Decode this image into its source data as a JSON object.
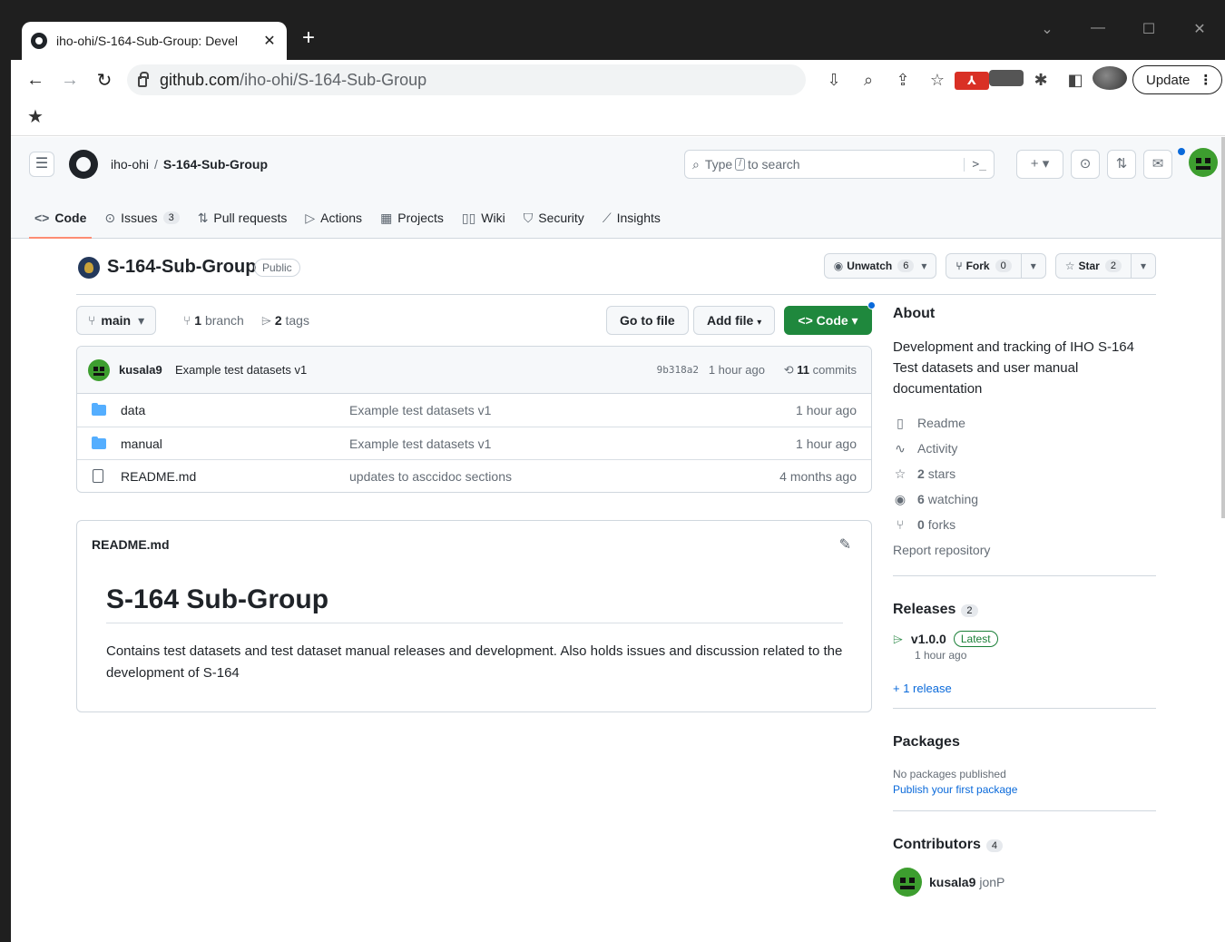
{
  "browser": {
    "tab_title": "iho-ohi/S-164-Sub-Group: Devel",
    "url_host": "github.com",
    "url_path": "/iho-ohi/S-164-Sub-Group",
    "update_label": "Update"
  },
  "header": {
    "owner": "iho-ohi",
    "separator": "/",
    "repo": "S-164-Sub-Group",
    "search_type": "Type",
    "search_key": "/",
    "search_rest": "to search"
  },
  "repo_nav": {
    "code": "Code",
    "issues": "Issues",
    "issues_count": "3",
    "pull_requests": "Pull requests",
    "actions": "Actions",
    "projects": "Projects",
    "wiki": "Wiki",
    "security": "Security",
    "insights": "Insights"
  },
  "repo": {
    "title": "S-164-Sub-Group",
    "visibility": "Public",
    "unwatch_label": "Unwatch",
    "watch_count": "6",
    "fork_label": "Fork",
    "fork_count": "0",
    "star_label": "Star",
    "star_count": "2"
  },
  "file_nav": {
    "branch": "main",
    "branch_count": "1",
    "branch_word": "branch",
    "tag_count": "2",
    "tag_word": "tags",
    "go_to_file": "Go to file",
    "add_file": "Add file",
    "code_button": "Code"
  },
  "latest_commit": {
    "author": "kusala9",
    "message": "Example test datasets v1",
    "sha": "9b318a2",
    "time": "1 hour ago",
    "commit_count": "11",
    "commit_word": "commits"
  },
  "files": [
    {
      "name": "data",
      "type": "folder",
      "message": "Example test datasets v1",
      "time": "1 hour ago"
    },
    {
      "name": "manual",
      "type": "folder",
      "message": "Example test datasets v1",
      "time": "1 hour ago"
    },
    {
      "name": "README.md",
      "type": "file",
      "message": "updates to asccidoc sections",
      "time": "4 months ago"
    }
  ],
  "readme": {
    "filename": "README.md",
    "heading": "S-164 Sub-Group",
    "body": "Contains test datasets and test dataset manual releases and development. Also holds issues and discussion related to the development of S-164"
  },
  "about": {
    "heading": "About",
    "description": "Development and tracking of IHO S-164 Test datasets and user manual documentation",
    "readme": "Readme",
    "activity": "Activity",
    "stars_count": "2",
    "stars_word": "stars",
    "watching_count": "6",
    "watching_word": "watching",
    "forks_count": "0",
    "forks_word": "forks",
    "report": "Report repository"
  },
  "releases": {
    "heading": "Releases",
    "count": "2",
    "tag": "v1.0.0",
    "badge": "Latest",
    "time": "1 hour ago",
    "more": "+ 1 release"
  },
  "packages": {
    "heading": "Packages",
    "none": "No packages published",
    "publish_link": "Publish your first package"
  },
  "contributors": {
    "heading": "Contributors",
    "count": "4",
    "first_login": "kusala9",
    "first_name": "jonP"
  },
  "colors": {
    "code_button": "#1f883d",
    "link": "#0969da",
    "active_tab_underline": "#fd8c73",
    "folder": "#54aeff"
  }
}
